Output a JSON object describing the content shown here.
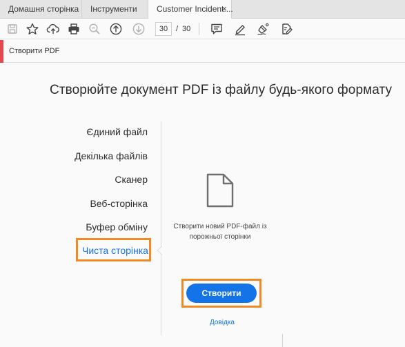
{
  "tabs": [
    {
      "label": "Домашня сторінка"
    },
    {
      "label": "Інструменти"
    },
    {
      "label": "Customer Incident....",
      "close": "×"
    }
  ],
  "toolbar": {
    "icons": [
      "save-icon",
      "bookmark-star-icon",
      "upload-cloud-icon",
      "print-icon",
      "zoom-out-icon",
      "page-up-icon",
      "page-down-icon",
      "comment-icon",
      "highlight-pen-icon",
      "sign-icon",
      "edit-pdf-icon"
    ],
    "page_current": "30",
    "page_separator": "/",
    "page_total": "30"
  },
  "tool_header": {
    "title": "Створити PDF"
  },
  "main": {
    "heading": "Створюйте документ PDF із файлу будь-якого формату",
    "options": [
      {
        "label": "Єдиний файл"
      },
      {
        "label": "Декілька файлів"
      },
      {
        "label": "Сканер"
      },
      {
        "label": "Веб-сторінка"
      },
      {
        "label": "Буфер обміну"
      },
      {
        "label": "Чиста сторінка",
        "selected": true
      }
    ],
    "description_line1": "Створити новий PDF-файл із",
    "description_line2": "порожньої сторінки",
    "create_button": "Створити",
    "help_link": "Довідка"
  },
  "colors": {
    "accent_red": "#e34850",
    "highlight_orange": "#f08a24",
    "link_blue": "#1473e6"
  }
}
